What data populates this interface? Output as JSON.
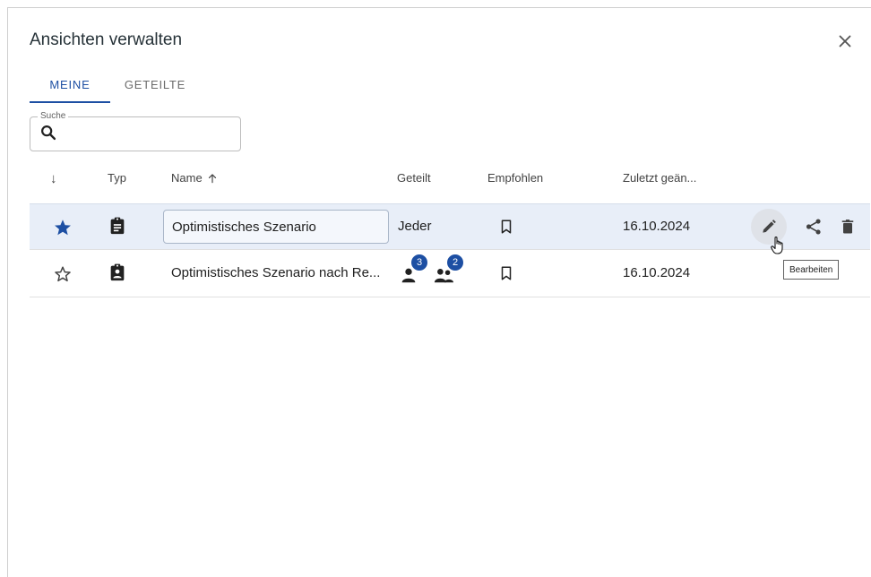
{
  "dialog": {
    "title": "Ansichten verwalten",
    "close_icon": "close-icon"
  },
  "tabs": [
    {
      "label": "MEINE",
      "active": true
    },
    {
      "label": "GETEILTE",
      "active": false
    }
  ],
  "search": {
    "legend": "Suche",
    "value": "",
    "icon": "search-icon"
  },
  "table": {
    "columns": {
      "favorite": "↓",
      "type": "Typ",
      "name": "Name",
      "name_sort_icon": "arrow-up-icon",
      "shared": "Geteilt",
      "recommended": "Empfohlen",
      "modified": "Zuletzt geän..."
    },
    "rows": [
      {
        "favorite": true,
        "type_icon": "clipboard-icon",
        "name": "Optimistisches Szenario",
        "shared": "Jeder",
        "recommended": false,
        "modified": "16.10.2024",
        "actions": [
          "edit-icon",
          "share-icon",
          "delete-icon"
        ]
      },
      {
        "favorite": false,
        "type_icon": "clipboard-person-icon",
        "name": "Optimistisches Szenario nach Re...",
        "shared_users": 3,
        "shared_groups": 2,
        "recommended": false,
        "modified": "16.10.2024"
      }
    ]
  },
  "tooltip": {
    "label": "Bearbeiten"
  },
  "colors": {
    "accent": "#1d4fa3",
    "selected_row": "#e8eef8"
  }
}
